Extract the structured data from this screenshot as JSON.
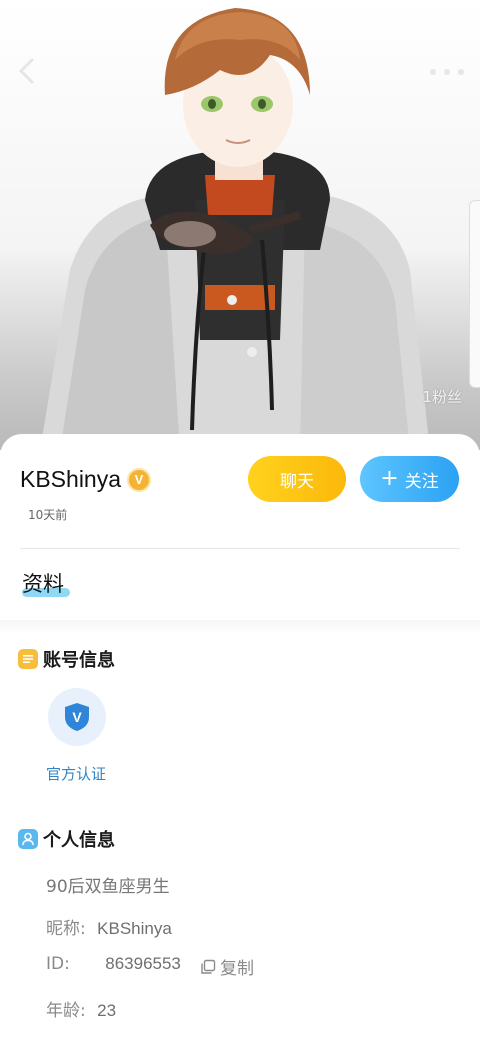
{
  "hero": {
    "fans_label": "1粉丝"
  },
  "profile": {
    "name": "KBShinya",
    "verified_mark": "V",
    "time_ago": "10天前"
  },
  "actions": {
    "chat_label": "聊天",
    "follow_plus": "+",
    "follow_label": "关注"
  },
  "tabs": {
    "active": "资料"
  },
  "account_section": {
    "title": "账号信息",
    "auth_mark": "V",
    "auth_label": "官方认证"
  },
  "personal_section": {
    "title": "个人信息",
    "bio": "90后双鱼座男生",
    "nickname_key": "昵称:",
    "nickname_value": "KBShinya",
    "id_key": "ID:",
    "id_value": "86396553",
    "copy_label": "复制",
    "age_key": "年龄:",
    "age_value": "23"
  },
  "colors": {
    "chat_button": "#fbc412",
    "follow_button": "#3ab0fa",
    "verified_badge": "#f5b335",
    "auth_text": "#2f86c9",
    "tab_underline": "#8fd8f5"
  },
  "icons": [
    "back-arrow-icon",
    "more-dots-icon",
    "verified-v-icon",
    "list-icon",
    "user-icon",
    "shield-v-icon",
    "copy-icon"
  ]
}
